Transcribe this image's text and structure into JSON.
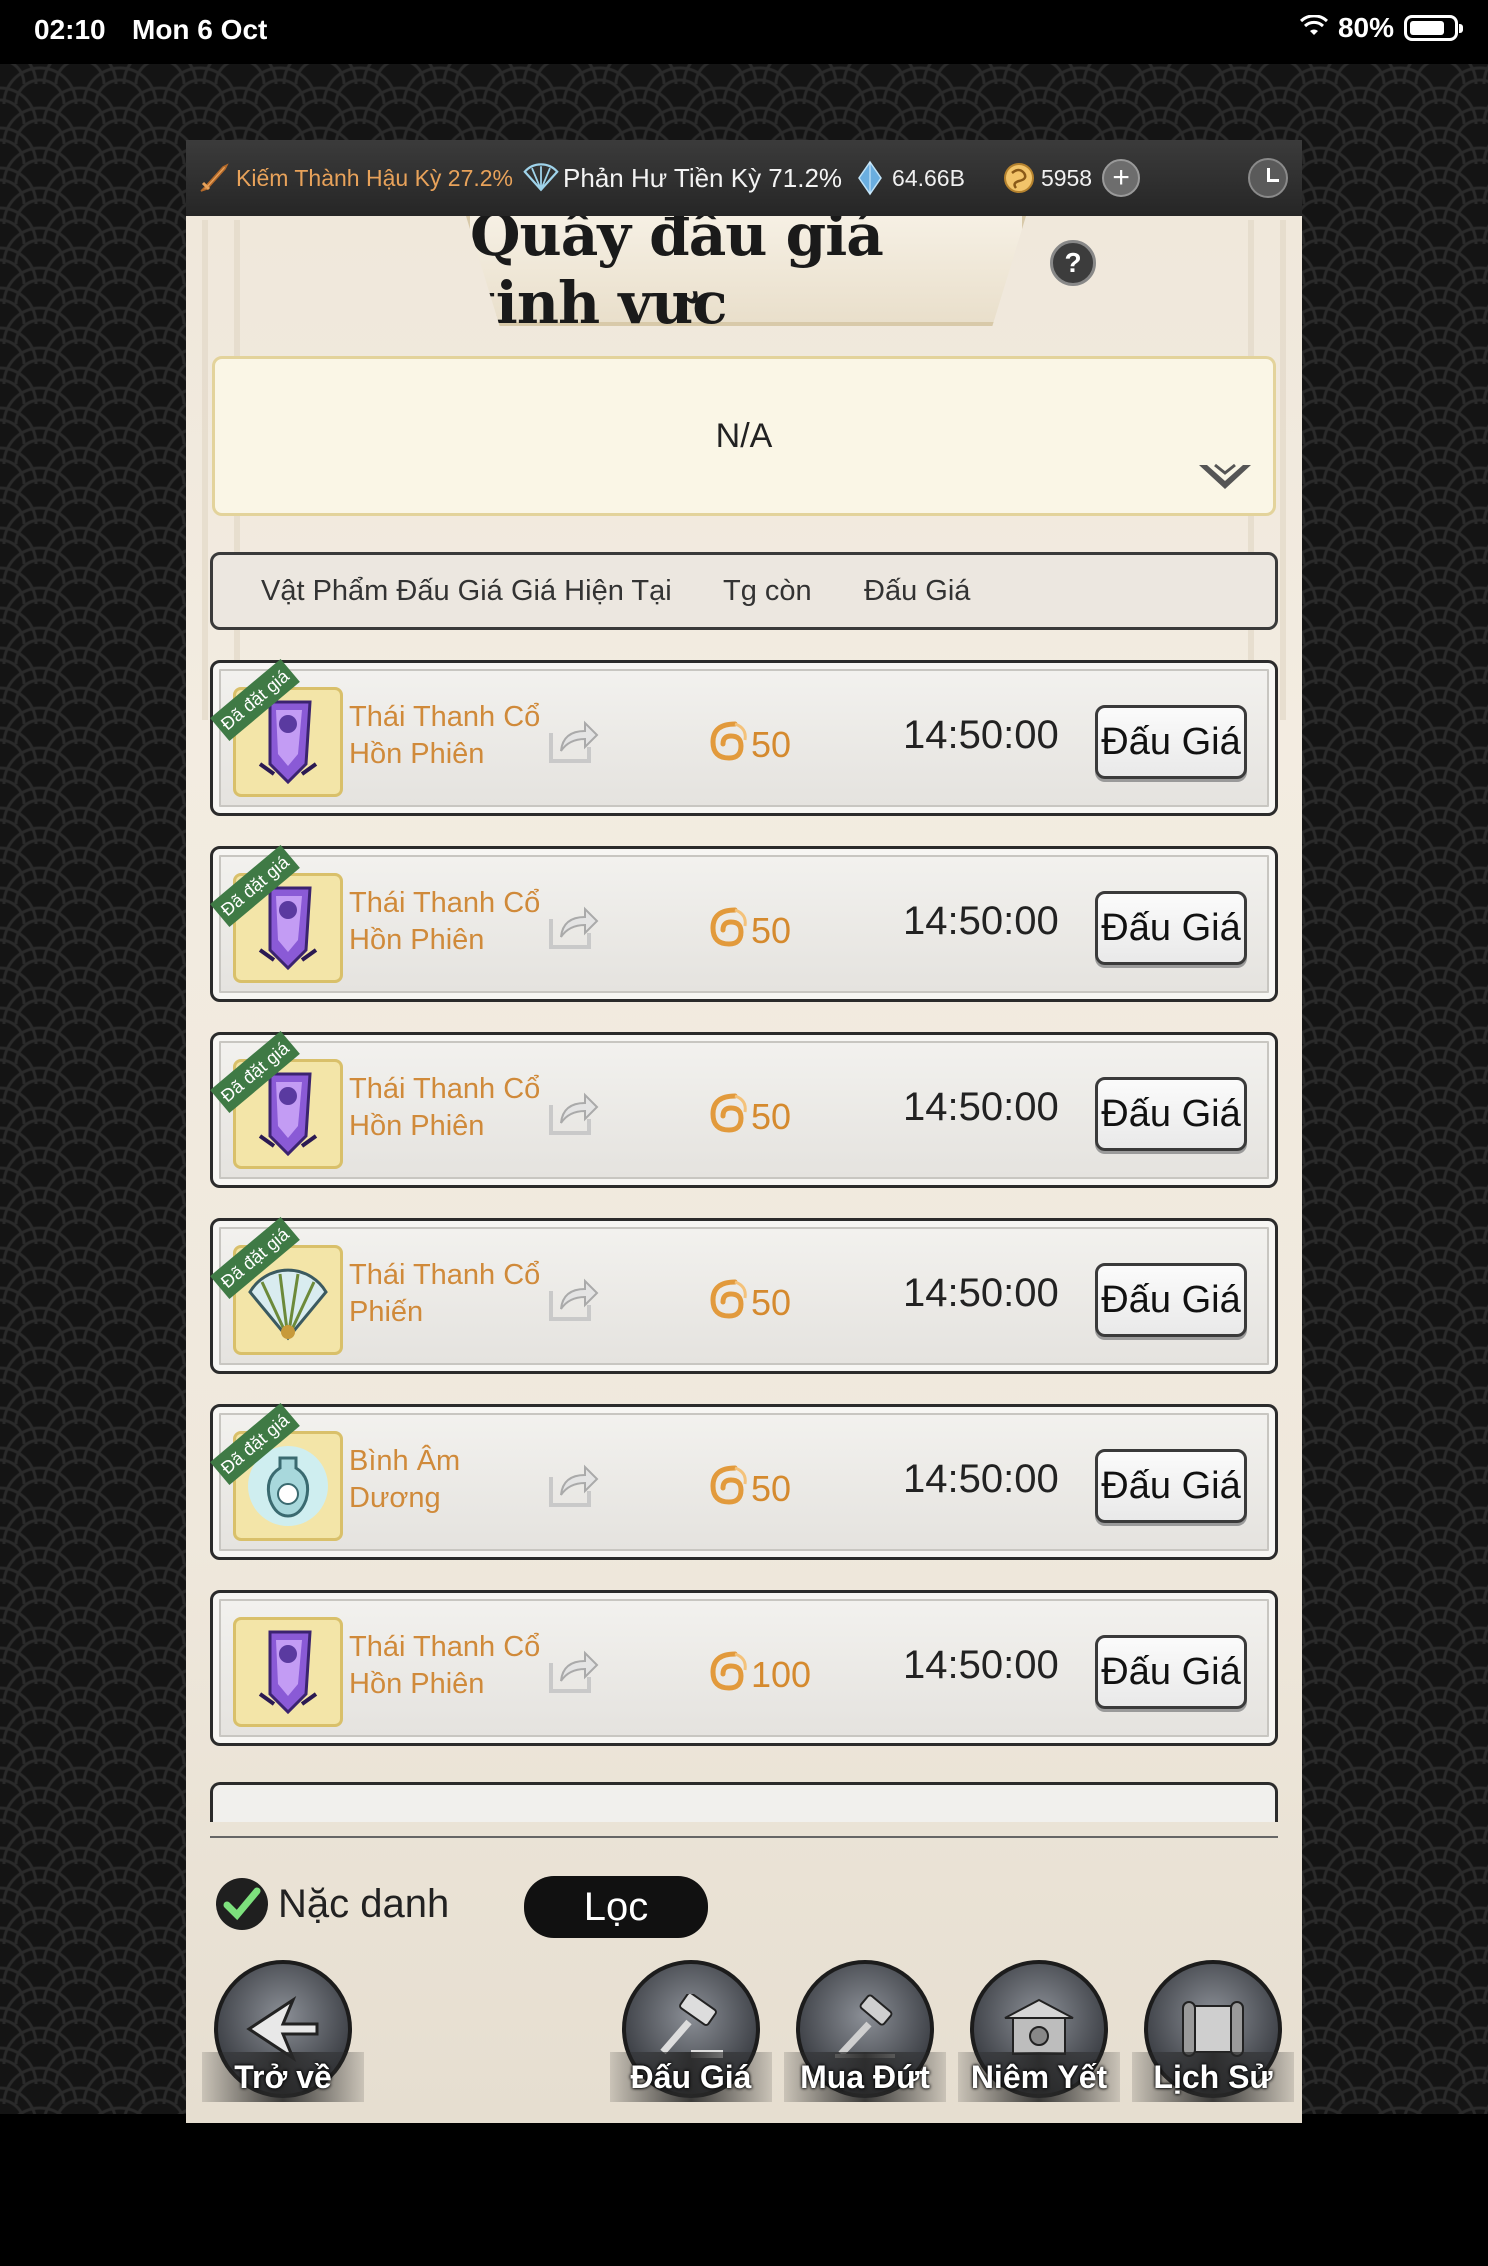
{
  "status_bar": {
    "time": "02:10",
    "date": "Mon 6 Oct",
    "battery": "80%",
    "battery_level": 0.8
  },
  "resources": {
    "cultivation_1": "Kiếm Thành Hậu Kỳ 27.2%",
    "cultivation_2": "Phản Hư Tiền Kỳ 71.2%",
    "spirit_stones": "64.66B",
    "currency": "5958"
  },
  "header": {
    "title": "Quầy đấu giá tinh vực",
    "help": "?"
  },
  "info_box": {
    "text": "N/A"
  },
  "columns": {
    "item": "Vật Phẩm Đấu Giá",
    "price": "Giá Hiện Tại",
    "time": "Tg còn",
    "bid": "Đấu Giá"
  },
  "rows": [
    {
      "name": "Thái Thanh Cổ Hồn Phiên",
      "price": "50",
      "time": "14:50:00",
      "button": "Đấu Giá",
      "badge": "Đã đặt giá",
      "icon": "purple-banner-icon"
    },
    {
      "name": "Thái Thanh Cổ Hồn Phiên",
      "price": "50",
      "time": "14:50:00",
      "button": "Đấu Giá",
      "badge": "Đã đặt giá",
      "icon": "purple-banner-icon"
    },
    {
      "name": "Thái Thanh Cổ Hồn Phiên",
      "price": "50",
      "time": "14:50:00",
      "button": "Đấu Giá",
      "badge": "Đã đặt giá",
      "icon": "purple-banner-icon"
    },
    {
      "name": "Thái Thanh Cổ Phiến",
      "price": "50",
      "time": "14:50:00",
      "button": "Đấu Giá",
      "badge": "Đã đặt giá",
      "icon": "feather-fan-icon"
    },
    {
      "name": "Bình Âm Dương",
      "price": "50",
      "time": "14:50:00",
      "button": "Đấu Giá",
      "badge": "Đã đặt giá",
      "icon": "yin-yang-vase-icon"
    },
    {
      "name": "Thái Thanh Cổ Hồn Phiên",
      "price": "100",
      "time": "14:50:00",
      "button": "Đấu Giá",
      "badge": "",
      "icon": "purple-banner-icon"
    }
  ],
  "controls": {
    "anonymous_label": "Nặc danh",
    "anonymous_checked": true,
    "filter_label": "Lọc"
  },
  "nav": {
    "back": "Trở về",
    "auction": "Đấu Giá",
    "buyout": "Mua Đứt",
    "listing": "Niêm Yết",
    "history": "Lịch Sử"
  },
  "colors": {
    "item_name": "#d08a3a",
    "price": "#d58a2e",
    "badge": "#3f7a45",
    "cultivation_text": "#e8a25a"
  }
}
